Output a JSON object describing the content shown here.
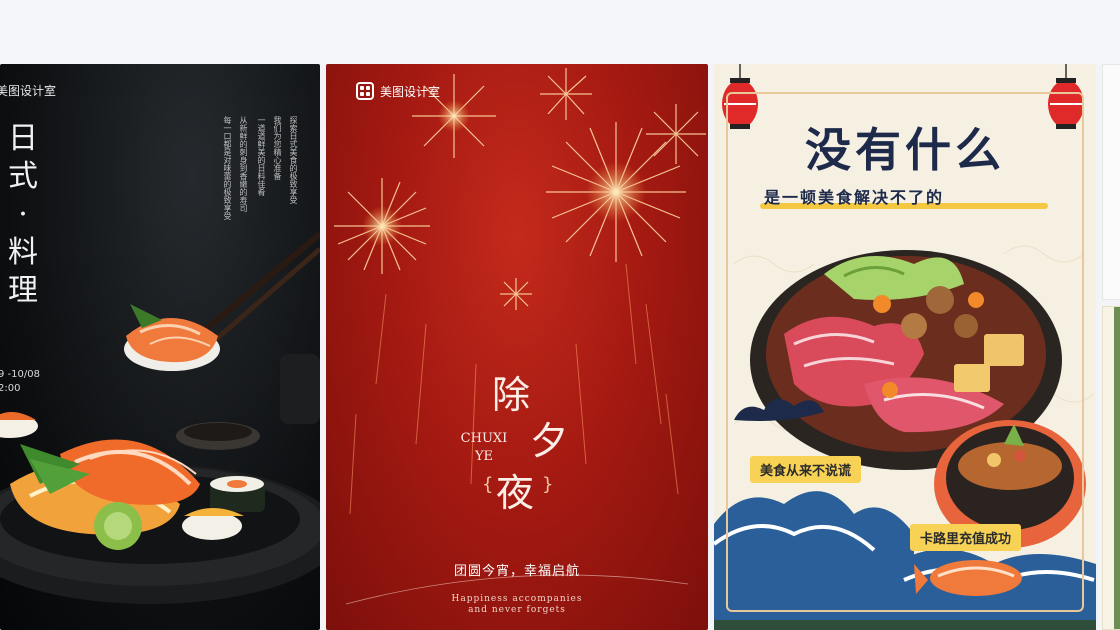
{
  "cards": [
    {
      "brand": "美图设计室",
      "title_chars": [
        "日",
        "式",
        "·",
        "料",
        "理"
      ],
      "desc_cols": [
        "探索日式美食的极致享受",
        "我们为您精心准备",
        "一道道鲜美的日料佳肴",
        "从新鲜的刺身到香嫩的寿司",
        "每一口都是对味蕾的极致享受"
      ],
      "date_line1": "9 -10/08",
      "date_line2": "2:00"
    },
    {
      "brand": "美图设计室",
      "title_chars": [
        "除",
        "夕",
        "夜"
      ],
      "pinyin_1": "CHUXI",
      "pinyin_2": "YE",
      "slogan": "团圆今宵，幸福启航",
      "en_line1": "Happiness accompanies",
      "en_line2": "and never forgets"
    },
    {
      "title": "没有什么",
      "subtitle": "是一顿美食解决不了的",
      "tag1": "美食从来不说谎",
      "tag2": "卡路里充值成功"
    }
  ],
  "colors": {
    "c1_bg": "#0d0f11",
    "c2_bg": "#a51a12",
    "c3_bg": "#f6f0e3",
    "c3_title": "#1e2a4a",
    "c3_accent": "#f5c842"
  }
}
